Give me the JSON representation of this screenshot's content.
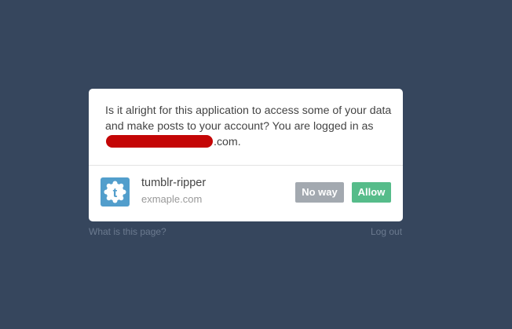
{
  "dialog": {
    "message_prefix": "Is it alright for this application to access some of your data and make posts to your account? You are logged in as",
    "message_suffix": ".com."
  },
  "app": {
    "icon": "tumblr-t-icon",
    "name": "tumblr-ripper",
    "domain": "exmaple.com"
  },
  "buttons": {
    "deny_label": "No way",
    "allow_label": "Allow"
  },
  "footer": {
    "what_link": "What is this page?",
    "logout_link": "Log out"
  },
  "colors": {
    "background": "#36465d",
    "allow": "#56bc8a",
    "deny": "#a3a9b0",
    "app_icon": "#529ecc",
    "redaction": "#c40606"
  }
}
